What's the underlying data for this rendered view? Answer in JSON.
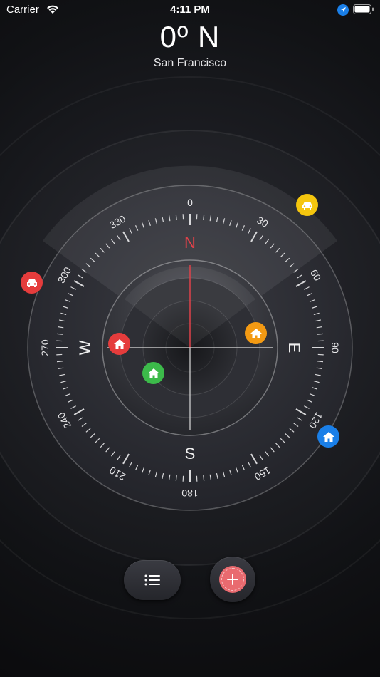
{
  "status_bar": {
    "carrier": "Carrier",
    "time": "4:11 PM"
  },
  "heading": {
    "value": "0º N",
    "city": "San Francisco"
  },
  "compass": {
    "degree_labels": [
      "0",
      "30",
      "60",
      "90",
      "120",
      "150",
      "180",
      "210",
      "240",
      "270",
      "300",
      "330"
    ],
    "cardinals": {
      "north": "N",
      "east": "E",
      "south": "S",
      "west": "W"
    },
    "colors": {
      "north_accent": "#e0424a",
      "tick": "#d8d8da"
    }
  },
  "markers": [
    {
      "name": "car-marker-yellow",
      "icon": "car-icon",
      "color": "#f5c60e"
    },
    {
      "name": "car-marker-red",
      "icon": "car-icon",
      "color": "#e53c3c"
    },
    {
      "name": "home-marker-blue",
      "icon": "home-icon",
      "color": "#1a7fe8"
    },
    {
      "name": "home-marker-red",
      "icon": "home-icon",
      "color": "#e53c3c"
    },
    {
      "name": "home-marker-orange",
      "icon": "home-icon",
      "color": "#f39a13"
    },
    {
      "name": "home-marker-green",
      "icon": "home-icon",
      "color": "#3cba4a"
    }
  ],
  "toolbar": {
    "list_icon": "list-icon",
    "add_icon": "add-icon",
    "add_color": "#e96a6f"
  }
}
